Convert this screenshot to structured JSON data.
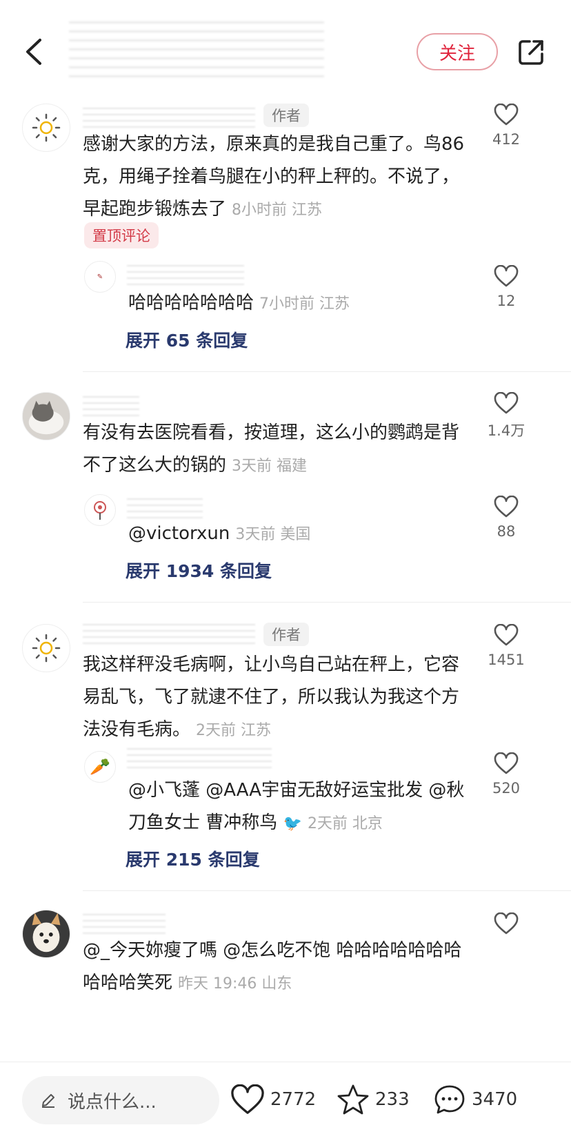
{
  "header": {
    "follow_label": "关注"
  },
  "comments": [
    {
      "author_tag": "作者",
      "text": "感谢大家的方法，原来真的是我自己重了。鸟86克，用绳子拴着鸟腿在小的秤上秤的。不说了，早起跑步锻炼去了",
      "meta": "8小时前 江苏",
      "likes": "412",
      "pinned_label": "置顶评论",
      "reply": {
        "text": "哈哈哈哈哈哈哈",
        "meta": "7小时前 江苏",
        "likes": "12"
      },
      "expand": "展开 65 条回复"
    },
    {
      "text": "有没有去医院看看，按道理，这么小的鹦鹉是背不了这么大的锅的",
      "meta": "3天前 福建",
      "likes": "1.4万",
      "reply": {
        "text": "@victorxun",
        "meta": "3天前 美国",
        "likes": "88"
      },
      "expand": "展开 1934 条回复"
    },
    {
      "author_tag": "作者",
      "text": "我这样秤没毛病啊，让小鸟自己站在秤上，它容易乱飞，飞了就逮不住了，所以我认为我这个方法没有毛病。",
      "meta": "2天前 江苏",
      "likes": "1451",
      "reply": {
        "text": "@小飞蓬 @AAA宇宙无敌好运宝批发 @秋刀鱼女士 曹冲称鸟",
        "meta": "2天前 北京",
        "likes": "520"
      },
      "expand": "展开 215 条回复"
    },
    {
      "text": "@_今天妳瘦了嗎 @怎么吃不饱 哈哈哈哈哈哈哈哈哈哈笑死",
      "meta": "昨天 19:46 山东",
      "likes": ""
    }
  ],
  "bottom": {
    "input_placeholder": "说点什么...",
    "likes": "2772",
    "stars": "233",
    "comments": "3470"
  },
  "colors": {
    "accent": "#e0243c",
    "link": "#2a3a6e"
  }
}
